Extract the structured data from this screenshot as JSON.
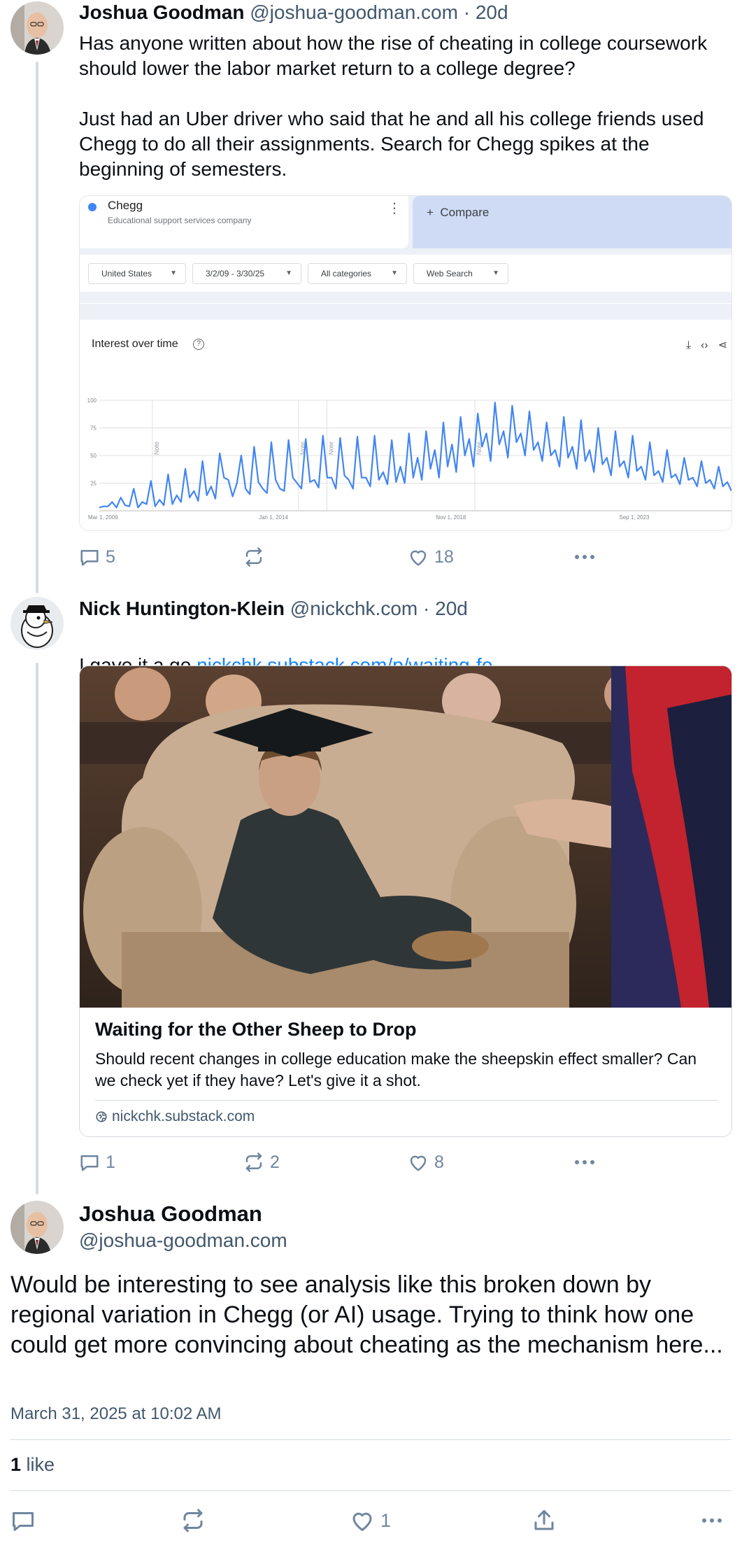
{
  "posts": [
    {
      "author": "Joshua Goodman",
      "handle": "@joshua-goodman.com",
      "separator": "·",
      "age": "20d",
      "text": "Has anyone written about how the rise of cheating in college coursework should lower the labor market return to a college degree?\n\nJust had an Uber driver who said that he and all his college friends used Chegg to do all their assignments. Search for Chegg spikes at the beginning of semesters.",
      "actions": {
        "replies": "5",
        "reposts": "",
        "likes": "18"
      }
    },
    {
      "author": "Nick Huntington-Klein",
      "handle": "@nickchk.com",
      "separator": "·",
      "age": "20d",
      "text": "I gave it a go ",
      "link_text": "nickchk.substack.com/p/waiting-fo...",
      "card": {
        "title": "Waiting for the Other Sheep to Drop",
        "description": "Should recent changes in college education make the sheepskin effect smaller? Can we check yet if they have? Let's give it a shot.",
        "domain": "nickchk.substack.com"
      },
      "actions": {
        "replies": "1",
        "reposts": "2",
        "likes": "8"
      }
    }
  ],
  "trends_embed": {
    "term": "Chegg",
    "term_subtitle": "Educational support services company",
    "compare_label": "Compare",
    "filters": [
      "United States",
      "3/2/09 - 3/30/25",
      "All categories",
      "Web Search"
    ],
    "panel_title": "Interest over time",
    "help_icon": "?",
    "icons": [
      "download-icon",
      "embed-icon",
      "share-icon"
    ]
  },
  "chart_data": {
    "type": "line",
    "series": [
      {
        "values": [
          3,
          4,
          4,
          8,
          3,
          12,
          5,
          4,
          20,
          3,
          8,
          6,
          27,
          4,
          10,
          5,
          33,
          6,
          14,
          8,
          38,
          12,
          18,
          9,
          45,
          14,
          22,
          11,
          52,
          30,
          28,
          13,
          25,
          50,
          20,
          15,
          58,
          26,
          20,
          16,
          62,
          28,
          20,
          18,
          64,
          30,
          25,
          20,
          65,
          26,
          28,
          21,
          68,
          30,
          30,
          20,
          66,
          32,
          28,
          20,
          67,
          30,
          30,
          22,
          68,
          28,
          35,
          24,
          64,
          26,
          40,
          25,
          70,
          30,
          48,
          28,
          72,
          38,
          55,
          30,
          80,
          40,
          60,
          35,
          85,
          50,
          65,
          40,
          88,
          58,
          70,
          45,
          98,
          60,
          72,
          48,
          95,
          62,
          70,
          50,
          90,
          55,
          62,
          45,
          80,
          50,
          55,
          40,
          85,
          48,
          58,
          38,
          82,
          45,
          55,
          35,
          75,
          42,
          48,
          32,
          72,
          40,
          45,
          30,
          68,
          36,
          40,
          28,
          62,
          32,
          36,
          26,
          55,
          30,
          33,
          24,
          48,
          28,
          30,
          22,
          45,
          25,
          28,
          20,
          40,
          22,
          26,
          18
        ]
      }
    ],
    "ylim": [
      0,
      100
    ],
    "y_ticks": [
      "100",
      "75",
      "50",
      "25"
    ],
    "x_ticks": [
      "Mar 1, 2009",
      "Jan 1, 2014",
      "Nov 1, 2018",
      "Sep 1, 2023"
    ],
    "annotations": [
      "Note",
      "Note",
      "Note",
      "Note"
    ],
    "color": "#4285f4"
  },
  "main_post": {
    "author": "Joshua Goodman",
    "handle": "@joshua-goodman.com",
    "text": "Would be interesting to see analysis like this broken down by regional variation in Chegg (or AI) usage. Trying to think how one could get more convincing about cheating as the mechanism here...",
    "date": "March 31, 2025 at 10:02 AM",
    "like_count": "1",
    "like_word": "like",
    "bottom_like_count": "1"
  },
  "colors": {
    "link": "#1083fe",
    "muted": "#42576c",
    "icon": "#6f869f",
    "line": "#d4dbe2"
  }
}
